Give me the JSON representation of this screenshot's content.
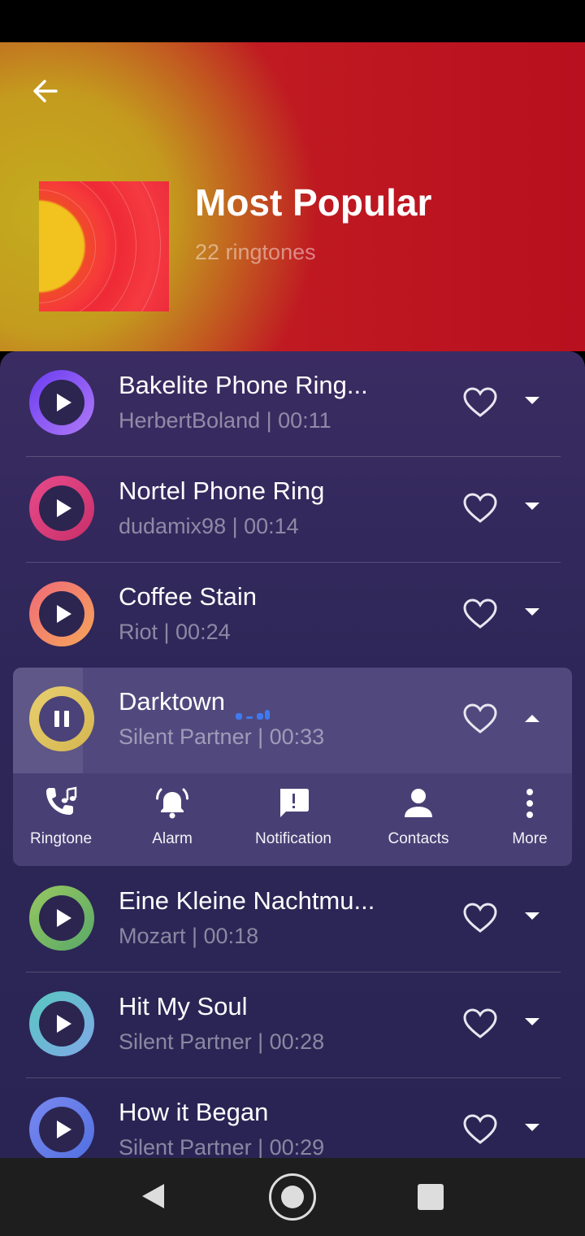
{
  "header": {
    "title": "Most Popular",
    "count_label": "22 ringtones"
  },
  "songs": [
    {
      "title": "Bakelite Phone Ring...",
      "meta": "HerbertBoland | 00:11",
      "ring": "#7b4df0",
      "ring2": "#a26bf5",
      "state": "play",
      "icon": "play-icon"
    },
    {
      "title": "Nortel Phone Ring",
      "meta": "dudamix98 | 00:14",
      "ring": "#e84a8a",
      "ring2": "#d8357a",
      "state": "play",
      "icon": "play-icon"
    },
    {
      "title": "Coffee Stain",
      "meta": "Riot | 00:24",
      "ring": "#f07a6a",
      "ring2": "#f5a060",
      "state": "play",
      "icon": "play-icon"
    },
    {
      "title": "Darktown",
      "meta": "Silent Partner | 00:33",
      "ring": "#e6c96a",
      "ring2": "#d8bb55",
      "state": "pause",
      "icon": "pause-icon"
    },
    {
      "title": "Eine Kleine Nachtmu...",
      "meta": "Mozart | 00:18",
      "ring": "#86c065",
      "ring2": "#5fa862",
      "state": "play",
      "icon": "play-icon"
    },
    {
      "title": "Hit My Soul",
      "meta": "Silent Partner | 00:28",
      "ring": "#5fc0c8",
      "ring2": "#7fb0e0",
      "state": "play",
      "icon": "play-icon"
    },
    {
      "title": "How it Began",
      "meta": "Silent Partner | 00:29",
      "ring": "#6a8ae8",
      "ring2": "#5a70e0",
      "state": "play",
      "icon": "play-icon"
    }
  ],
  "actions": [
    {
      "label": "Ringtone",
      "icon": "phone-music-icon"
    },
    {
      "label": "Alarm",
      "icon": "alarm-bell-icon"
    },
    {
      "label": "Notification",
      "icon": "notification-icon"
    },
    {
      "label": "Contacts",
      "icon": "contact-person-icon"
    },
    {
      "label": "More",
      "icon": "more-vertical-icon"
    }
  ],
  "colors": {
    "header_gold": "#c4ac1e",
    "header_red": "#b8101e",
    "list_bg": "#2e2658",
    "wave_blue": "#3f7af0"
  }
}
